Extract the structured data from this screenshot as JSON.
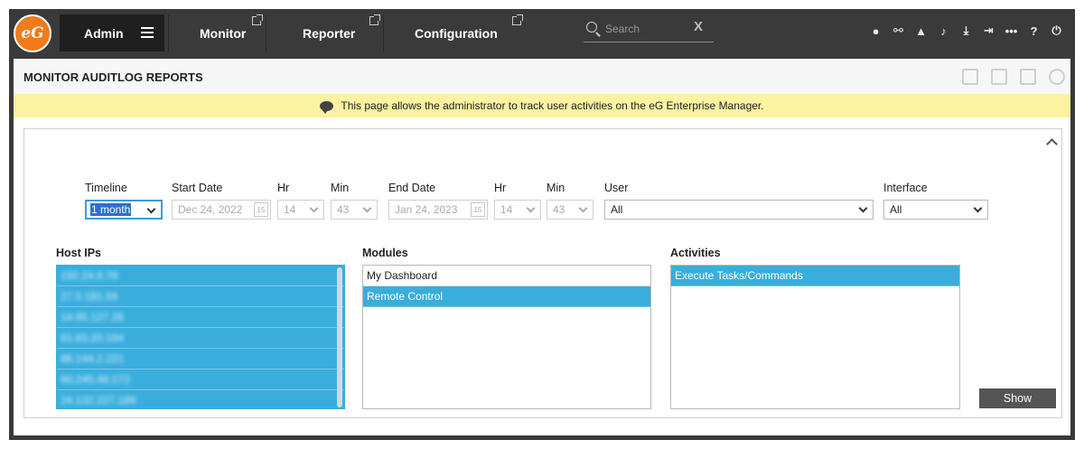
{
  "nav": {
    "logo_text": "eG",
    "admin_label": "Admin",
    "tabs": [
      {
        "label": "Monitor"
      },
      {
        "label": "Reporter"
      },
      {
        "label": "Configuration"
      }
    ],
    "search_placeholder": "Search",
    "search_clear": "X",
    "tool_icons": [
      "user-icon",
      "link-icon",
      "chart-icon",
      "bell-icon",
      "download-icon",
      "login-icon",
      "more-icon",
      "help-icon",
      "power-icon"
    ],
    "tool_glyphs": [
      "●",
      "⚯",
      "▲",
      "♪",
      "⤓",
      "⇥",
      "•••",
      "?",
      "⏻"
    ]
  },
  "page": {
    "title": "MONITOR AUDITLOG REPORTS",
    "info": "This page allows the administrator to track user activities on the eG Enterprise Manager."
  },
  "form": {
    "timeline_label": "Timeline",
    "timeline_value": "1 month",
    "start_date_label": "Start Date",
    "start_date_value": "Dec 24, 2022",
    "start_hr_label": "Hr",
    "start_hr_value": "14",
    "start_min_label": "Min",
    "start_min_value": "43",
    "end_date_label": "End Date",
    "end_date_value": "Jan 24, 2023",
    "end_hr_label": "Hr",
    "end_hr_value": "14",
    "end_min_label": "Min",
    "end_min_value": "43",
    "user_label": "User",
    "user_value": "All",
    "interface_label": "Interface",
    "interface_value": "All",
    "calendar_glyph": "15"
  },
  "host_ips": {
    "label": "Host IPs",
    "items": [
      "192.24.9.76",
      "27.5.181.56",
      "14.95.127.26",
      "61.83.20.164",
      "86.144.2.221",
      "60.245.46.172",
      "24.132.227.189"
    ]
  },
  "modules": {
    "label": "Modules",
    "items": [
      {
        "text": "My Dashboard",
        "selected": false
      },
      {
        "text": "Remote Control",
        "selected": true
      }
    ]
  },
  "activities": {
    "label": "Activities",
    "items": [
      {
        "text": "Execute Tasks/Commands",
        "selected": true
      }
    ]
  },
  "show_button": "Show",
  "colors": {
    "nav_bg": "#3a3a3a",
    "accent": "#39aedd",
    "info_bg": "#fbf2a2",
    "logo": "#f07a1c"
  }
}
